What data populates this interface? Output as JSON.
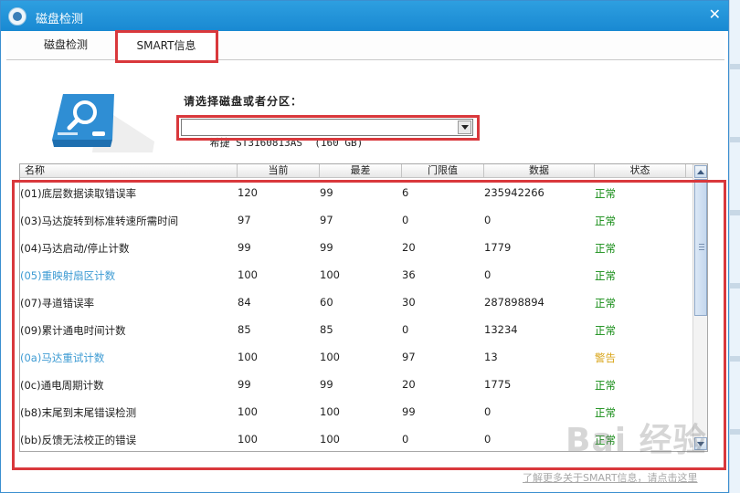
{
  "window": {
    "title": "磁盘检测"
  },
  "tabs": [
    {
      "label": "磁盘检测",
      "active": false
    },
    {
      "label": "SMART信息",
      "active": true
    }
  ],
  "disk_select": {
    "label": "请选择磁盘或者分区：",
    "value": "希捷 ST3160813AS  (160 GB)"
  },
  "table": {
    "columns": [
      "名称",
      "当前",
      "最差",
      "门限值",
      "数据",
      "状态"
    ],
    "rows": [
      {
        "name": "(01)底层数据读取错误率",
        "current": "120",
        "worst": "99",
        "threshold": "6",
        "data": "235942266",
        "status": "正常",
        "status_type": "ok",
        "highlight": false
      },
      {
        "name": "(03)马达旋转到标准转速所需时间",
        "current": "97",
        "worst": "97",
        "threshold": "0",
        "data": "0",
        "status": "正常",
        "status_type": "ok",
        "highlight": false
      },
      {
        "name": "(04)马达启动/停止计数",
        "current": "99",
        "worst": "99",
        "threshold": "20",
        "data": "1779",
        "status": "正常",
        "status_type": "ok",
        "highlight": false
      },
      {
        "name": "(05)重映射扇区计数",
        "current": "100",
        "worst": "100",
        "threshold": "36",
        "data": "0",
        "status": "正常",
        "status_type": "ok",
        "highlight": true
      },
      {
        "name": "(07)寻道错误率",
        "current": "84",
        "worst": "60",
        "threshold": "30",
        "data": "287898894",
        "status": "正常",
        "status_type": "ok",
        "highlight": false
      },
      {
        "name": "(09)累计通电时间计数",
        "current": "85",
        "worst": "85",
        "threshold": "0",
        "data": "13234",
        "status": "正常",
        "status_type": "ok",
        "highlight": false
      },
      {
        "name": "(0a)马达重试计数",
        "current": "100",
        "worst": "100",
        "threshold": "97",
        "data": "13",
        "status": "警告",
        "status_type": "warn",
        "highlight": true
      },
      {
        "name": "(0c)通电周期计数",
        "current": "99",
        "worst": "99",
        "threshold": "20",
        "data": "1775",
        "status": "正常",
        "status_type": "ok",
        "highlight": false
      },
      {
        "name": "(b8)末尾到末尾错误检测",
        "current": "100",
        "worst": "100",
        "threshold": "99",
        "data": "0",
        "status": "正常",
        "status_type": "ok",
        "highlight": false
      },
      {
        "name": "(bb)反馈无法校正的错误",
        "current": "100",
        "worst": "100",
        "threshold": "0",
        "data": "0",
        "status": "正常",
        "status_type": "ok",
        "highlight": false
      }
    ]
  },
  "footer_link": "了解更多关于SMART信息，请点击这里",
  "watermark": "Bai 经验",
  "colors": {
    "titlebar": "#1e8fd5",
    "highlight_box": "#d9383c",
    "status_ok": "#118a11",
    "status_warn": "#d9a51a",
    "link_blue": "#3d9bd3"
  },
  "icons": {
    "app_logo": "app-logo-icon",
    "close": "close-icon",
    "disk": "disk-search-icon"
  }
}
